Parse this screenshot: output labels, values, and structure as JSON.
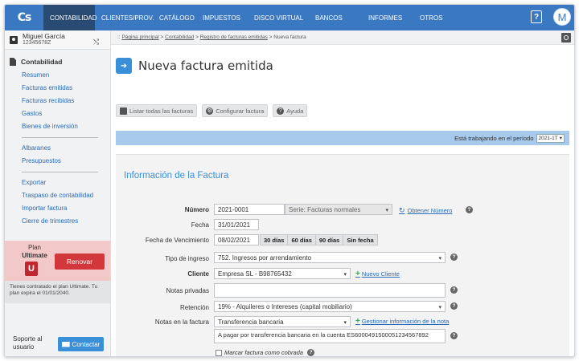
{
  "nav": {
    "logo": "Cs",
    "items": [
      "CONTABILIDAD",
      "CLIENTES/PROV.",
      "CATÁLOGO",
      "IMPUESTOS",
      "DISCO VIRTUAL",
      "BANCOS",
      "INFORMES",
      "OTROS"
    ],
    "active": "CONTABILIDAD",
    "help_glyph": "?",
    "avatar_letter": "M",
    "accent": "#3a79c1"
  },
  "user": {
    "name": "Miguel García",
    "id": "12345678Z"
  },
  "sidebar": {
    "section": "Contabilidad",
    "group1": [
      "Resumen",
      "Facturas emitidas",
      "Facturas recibidas",
      "Gastos",
      "Bienes de inversión"
    ],
    "group2": [
      "Albaranes",
      "Presupuestos"
    ],
    "group3": [
      "Exportar",
      "Traspaso de contabilidad",
      "Importar factura",
      "Cierre de trimestres"
    ]
  },
  "plan": {
    "label": "Plan",
    "name": "Ultimate",
    "badge": "U",
    "renew": "Renovar",
    "note": "Tienes contratado el plan Ultimate. Tu plan expira el 01/01/2040."
  },
  "support": {
    "label": "Soporte al usuario",
    "contact": "Contactar"
  },
  "breadcrumb": {
    "prefix": "::",
    "items": [
      "Página principal",
      "Contabilidad",
      "Registro de facturas emitidas"
    ],
    "current": "Nueva factura"
  },
  "page": {
    "title": "Nueva factura emitida"
  },
  "toolbar": {
    "list_all": "Listar todas las facturas",
    "configure": "Configurar factura",
    "help": "Ayuda"
  },
  "period": {
    "text": "Está trabajando en el período",
    "value": "2021-1T"
  },
  "form": {
    "heading": "Información de la Factura",
    "numero": {
      "label": "Número",
      "value": "2021-0001",
      "serie": "Serie: Facturas normales",
      "obtain": "Obtener Número"
    },
    "fecha": {
      "label": "Fecha",
      "value": "31/01/2021"
    },
    "vencimiento": {
      "label": "Fecha de Vencimiento",
      "value": "08/02/2021",
      "options": [
        "30 días",
        "60 días",
        "90 días",
        "Sin fecha"
      ]
    },
    "tipo_ingreso": {
      "label": "Tipo de ingreso",
      "value": "752. Ingresos por arrendamiento"
    },
    "cliente": {
      "label": "Cliente",
      "value": "Empresa SL - B98765432",
      "new": "Nuevo Cliente"
    },
    "notas_privadas": {
      "label": "Notas privadas",
      "value": ""
    },
    "retencion": {
      "label": "Retención",
      "value": "19% - Alquileres o Intereses (capital mobiliario)"
    },
    "notas_factura": {
      "label": "Notas en la factura",
      "value": "Transferencia bancaria",
      "manage": "Gestionar información de la nota",
      "text": "A pagar por transferencia bancaria en la cuenta ES6000491500051234567892"
    },
    "marcar_cobrada": "Marcar factura como cobrada"
  }
}
